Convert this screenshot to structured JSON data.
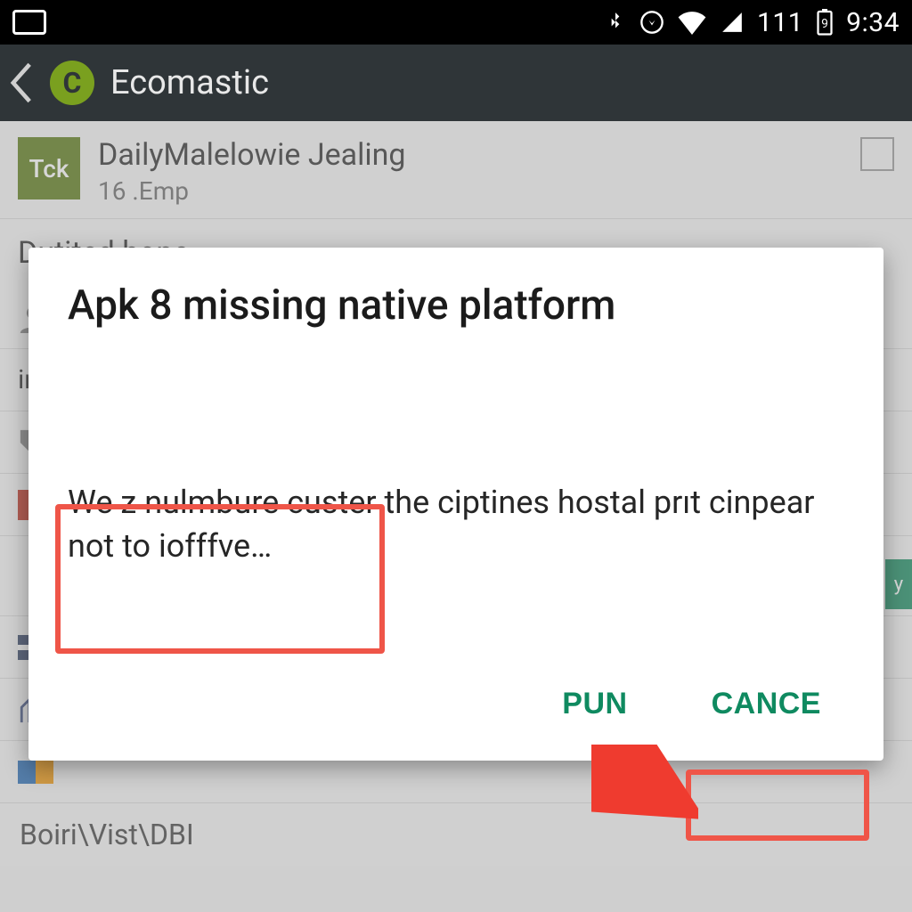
{
  "status_bar": {
    "badge": "111",
    "time": "9:34"
  },
  "app_bar": {
    "logo_letter": "C",
    "title": "Ecomastic"
  },
  "list": {
    "item0": {
      "avatar": "Tck",
      "title": "DailyMalelowie Jealing",
      "subtitle": "16 .Emp"
    },
    "heading1": "Dutited hono",
    "row2": "in",
    "row5_badge": "y",
    "bottom_label": "Boiri\\Vist\\DBI"
  },
  "dialog": {
    "title": "Apk 8 missing native platform",
    "body": "We z nulmbure custer the ciptines hostal prıt cinpear not to iofffve…",
    "btn_left": "PUN",
    "btn_right": "CANCE"
  }
}
